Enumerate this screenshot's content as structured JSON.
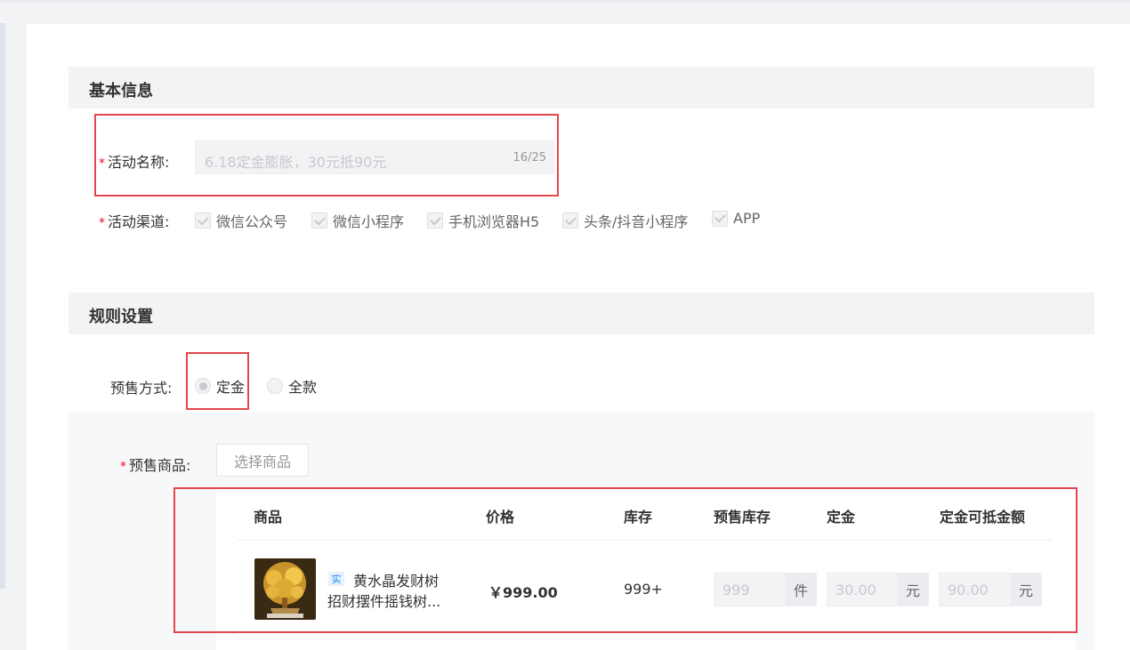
{
  "basic": {
    "title": "基本信息",
    "name_label": "活动名称:",
    "name_value": "6.18定金膨胀，30元抵90元",
    "name_count": "16/25",
    "channel_label": "活动渠道:",
    "channels": [
      "微信公众号",
      "微信小程序",
      "手机浏览器H5",
      "头条/抖音小程序",
      "APP"
    ]
  },
  "rules": {
    "title": "规则设置",
    "mode_label": "预售方式:",
    "options": [
      "定金",
      "全款"
    ],
    "selected": "定金",
    "goods_label": "预售商品:",
    "choose_button": "选择商品"
  },
  "table": {
    "headers": [
      "商品",
      "价格",
      "库存",
      "预售库存",
      "定金",
      "定金可抵金额"
    ],
    "rows": [
      {
        "tag": "实",
        "name_line1": "黄水晶发财树",
        "name_line2": "招财摆件摇钱树...",
        "price": "￥999.00",
        "stock": "999+",
        "presale_stock": "999",
        "presale_unit": "件",
        "deposit": "30.00",
        "deposit_unit": "元",
        "deduct": "90.00",
        "deduct_unit": "元"
      }
    ]
  },
  "colors": {
    "highlight": "#e3474d",
    "required": "#ee0a24"
  }
}
